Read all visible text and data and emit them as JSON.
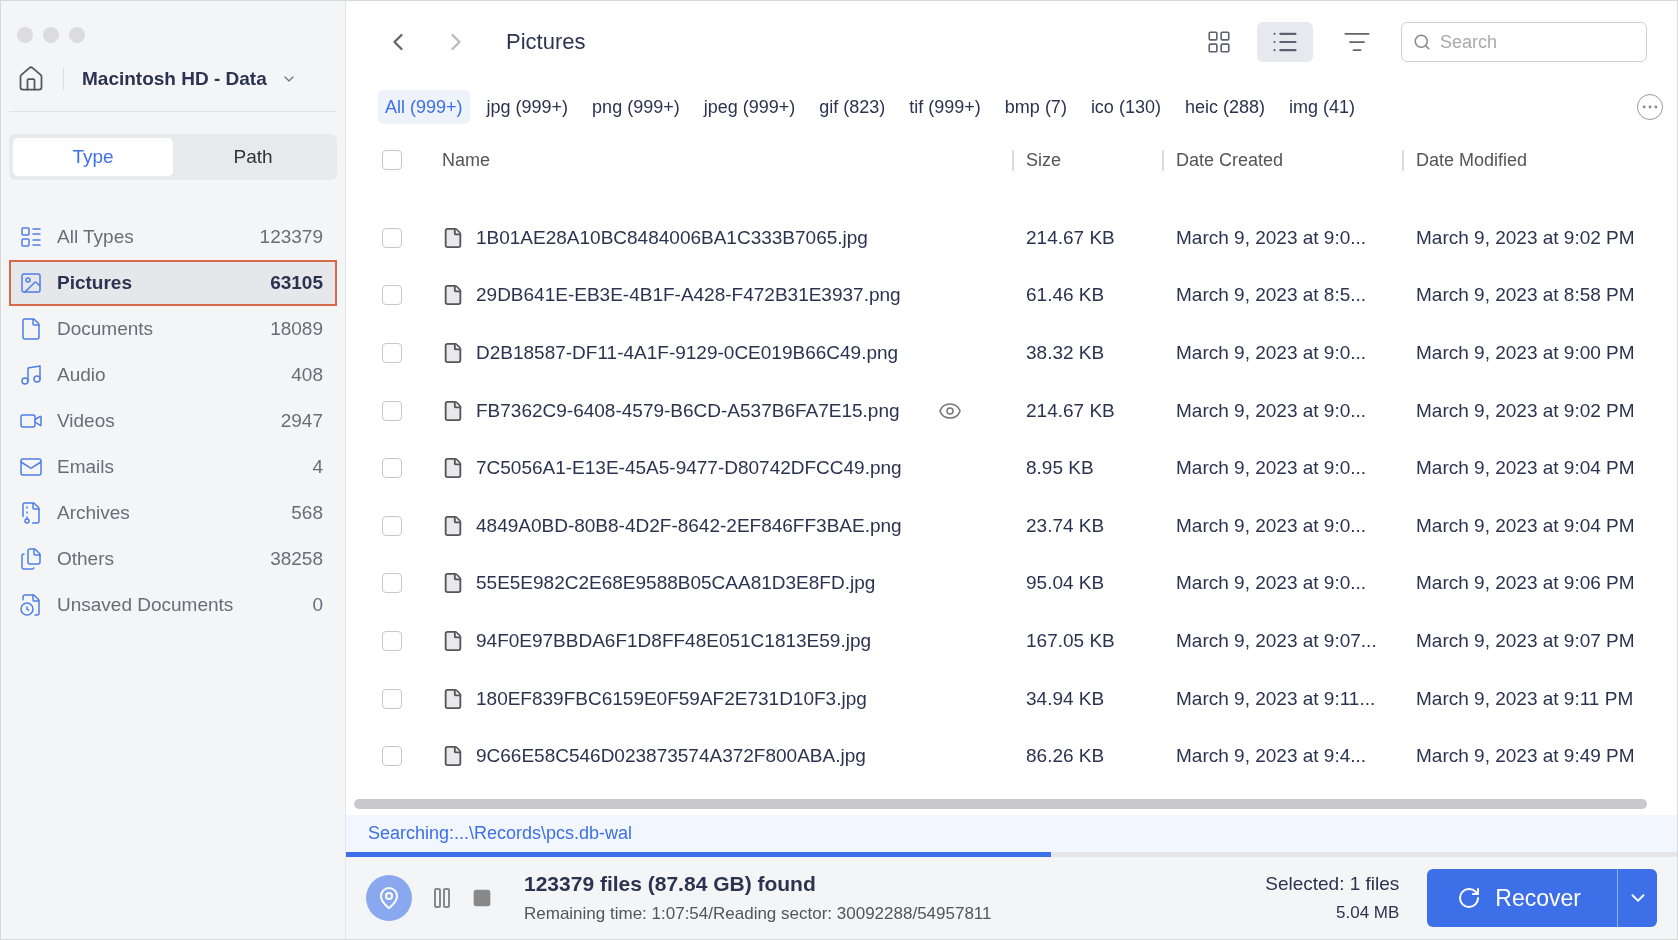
{
  "sidebar": {
    "drive": "Macintosh HD - Data",
    "tabs": [
      {
        "label": "Type",
        "selected": true
      },
      {
        "label": "Path",
        "selected": false
      }
    ],
    "items": [
      {
        "kind": "all",
        "label": "All Types",
        "count": "123379",
        "selected": false
      },
      {
        "kind": "pictures",
        "label": "Pictures",
        "count": "63105",
        "selected": true
      },
      {
        "kind": "documents",
        "label": "Documents",
        "count": "18089",
        "selected": false
      },
      {
        "kind": "audio",
        "label": "Audio",
        "count": "408",
        "selected": false
      },
      {
        "kind": "videos",
        "label": "Videos",
        "count": "2947",
        "selected": false
      },
      {
        "kind": "emails",
        "label": "Emails",
        "count": "4",
        "selected": false
      },
      {
        "kind": "archives",
        "label": "Archives",
        "count": "568",
        "selected": false
      },
      {
        "kind": "others",
        "label": "Others",
        "count": "38258",
        "selected": false
      },
      {
        "kind": "unsaved",
        "label": "Unsaved Documents",
        "count": "0",
        "selected": false
      }
    ]
  },
  "toolbar": {
    "title": "Pictures",
    "views": [
      {
        "kind": "grid",
        "selected": false
      },
      {
        "kind": "list",
        "selected": true
      }
    ],
    "search": {
      "placeholder": "Search"
    }
  },
  "filters": [
    {
      "label": "All (999+)",
      "selected": true
    },
    {
      "label": "jpg (999+)",
      "selected": false
    },
    {
      "label": "png (999+)",
      "selected": false
    },
    {
      "label": "jpeg (999+)",
      "selected": false
    },
    {
      "label": "gif (823)",
      "selected": false
    },
    {
      "label": "tif (999+)",
      "selected": false
    },
    {
      "label": "bmp (7)",
      "selected": false
    },
    {
      "label": "ico (130)",
      "selected": false
    },
    {
      "label": "heic (288)",
      "selected": false
    },
    {
      "label": "img (41)",
      "selected": false
    }
  ],
  "table": {
    "select_all": false,
    "columns": [
      "Name",
      "Size",
      "Date Created",
      "Date Modified"
    ],
    "rows": [
      {
        "name": "1B01AE28A10BC8484006BA1C333B7065.jpg",
        "size": "214.67 KB",
        "created": "March 9, 2023 at 9:0...",
        "modified": "March 9, 2023 at 9:02 PM",
        "checked": false,
        "preview": false
      },
      {
        "name": "29DB641E-EB3E-4B1F-A428-F472B31E3937.png",
        "size": "61.46 KB",
        "created": "March 9, 2023 at 8:5...",
        "modified": "March 9, 2023 at 8:58 PM",
        "checked": false,
        "preview": false
      },
      {
        "name": "D2B18587-DF11-4A1F-9129-0CE019B66C49.png",
        "size": "38.32 KB",
        "created": "March 9, 2023 at 9:0...",
        "modified": "March 9, 2023 at 9:00 PM",
        "checked": false,
        "preview": false
      },
      {
        "name": "FB7362C9-6408-4579-B6CD-A537B6FA7E15.png",
        "size": "214.67 KB",
        "created": "March 9, 2023 at 9:0...",
        "modified": "March 9, 2023 at 9:02 PM",
        "checked": false,
        "preview": true
      },
      {
        "name": "7C5056A1-E13E-45A5-9477-D80742DFCC49.png",
        "size": "8.95 KB",
        "created": "March 9, 2023 at 9:0...",
        "modified": "March 9, 2023 at 9:04 PM",
        "checked": false,
        "preview": false
      },
      {
        "name": "4849A0BD-80B8-4D2F-8642-2EF846FF3BAE.png",
        "size": "23.74 KB",
        "created": "March 9, 2023 at 9:0...",
        "modified": "March 9, 2023 at 9:04 PM",
        "checked": false,
        "preview": false
      },
      {
        "name": "55E5E982C2E68E9588B05CAA81D3E8FD.jpg",
        "size": "95.04 KB",
        "created": "March 9, 2023 at 9:0...",
        "modified": "March 9, 2023 at 9:06 PM",
        "checked": false,
        "preview": false
      },
      {
        "name": "94F0E97BBDA6F1D8FF48E051C1813E59.jpg",
        "size": "167.05 KB",
        "created": "March 9, 2023 at 9:07...",
        "modified": "March 9, 2023 at 9:07 PM",
        "checked": false,
        "preview": false
      },
      {
        "name": "180EF839FBC6159E0F59AF2E731D10F3.jpg",
        "size": "34.94 KB",
        "created": "March 9, 2023 at 9:11...",
        "modified": "March 9, 2023 at 9:11 PM",
        "checked": false,
        "preview": false
      },
      {
        "name": "9C66E58C546D023873574A372F800ABA.jpg",
        "size": "86.26 KB",
        "created": "March 9, 2023 at 9:4...",
        "modified": "March 9, 2023 at 9:49 PM",
        "checked": false,
        "preview": false
      }
    ]
  },
  "status": {
    "searching": "Searching:...\\Records\\pcs.db-wal",
    "level": 0.53,
    "found": "123379 files (87.84 GB) found",
    "remaining": "Remaining time: 1:07:54/Reading sector: 30092288/54957811",
    "selected": "Selected: 1 files",
    "size": "5.04 MB",
    "recover": "Recover"
  }
}
